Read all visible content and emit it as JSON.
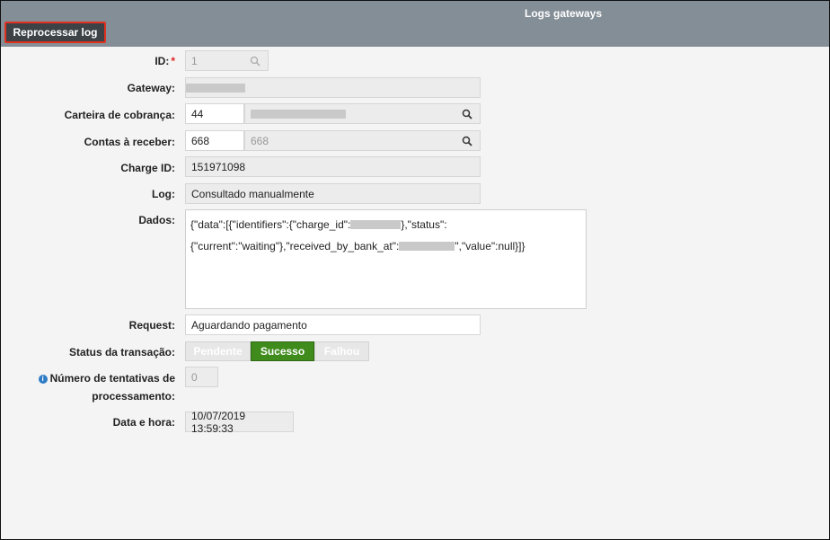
{
  "window": {
    "title": "Logs gateways"
  },
  "toolbar": {
    "reprocess_label": "Reprocessar log"
  },
  "form": {
    "id": {
      "label": "ID:",
      "required": "*",
      "value": "1"
    },
    "gateway": {
      "label": "Gateway:"
    },
    "carteira": {
      "label": "Carteira de cobrança:",
      "code": "44"
    },
    "contas": {
      "label": "Contas à receber:",
      "code": "668",
      "desc": "668"
    },
    "charge_id": {
      "label": "Charge ID:",
      "value": "151971098"
    },
    "log": {
      "label": "Log:",
      "value": "Consultado manualmente"
    },
    "dados": {
      "label": "Dados:",
      "line1_a": "{\"data\":[{\"identifiers\":{\"charge_id\":",
      "line1_b": "},\"status\":",
      "line2_a": "{\"current\":\"waiting\"},\"received_by_bank_at\":",
      "line2_b": "\",\"value\":null}]}"
    },
    "request": {
      "label": "Request:",
      "value": "Aguardando pagamento"
    },
    "status": {
      "label": "Status da transação:",
      "options": [
        "Pendente",
        "Sucesso",
        "Falhou"
      ],
      "selected": "Sucesso"
    },
    "tentativas": {
      "label_line1": "Número de tentativas de",
      "label_line2": "processamento:",
      "value": "0"
    },
    "data_hora": {
      "label": "Data e hora:",
      "value": "10/07/2019 13:59:33"
    }
  },
  "colors": {
    "header": "#848e97",
    "button": "#3d4247",
    "button_border": "#e0301e",
    "success": "#3f8b1c"
  }
}
